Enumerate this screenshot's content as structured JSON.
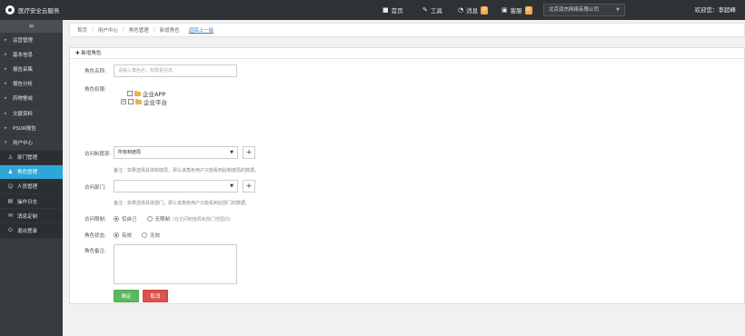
{
  "topbar": {
    "brand": "医疗安全云服务",
    "nav": [
      {
        "icon": "home-icon",
        "glyph": "■",
        "label": "首页"
      },
      {
        "icon": "wrench-icon",
        "glyph": "✎",
        "label": "工具"
      },
      {
        "icon": "bell-icon",
        "glyph": "◔",
        "label": "消息",
        "badge": "0"
      },
      {
        "icon": "service-icon",
        "glyph": "▣",
        "label": "客服",
        "badge": "0"
      }
    ],
    "company": "北京润杰网络有限公司",
    "welcome": "欢迎您：李超峰"
  },
  "sidebar": {
    "menu_icon": "menu-icon",
    "items": [
      {
        "label": "运营管理"
      },
      {
        "label": "基本信息"
      },
      {
        "label": "报告采集"
      },
      {
        "label": "报告分析"
      },
      {
        "label": "药物警戒"
      },
      {
        "label": "文献资料"
      },
      {
        "label": "PSUR报告"
      },
      {
        "label": "用户中心"
      }
    ],
    "children": [
      {
        "label": "部门管理",
        "icon": "org-icon",
        "glyph": "♙"
      },
      {
        "label": "角色管理",
        "icon": "role-icon",
        "glyph": "♟",
        "active": true
      },
      {
        "label": "人员管理",
        "icon": "user-icon",
        "glyph": "☺"
      },
      {
        "label": "操作日志",
        "icon": "log-icon",
        "glyph": "▤"
      },
      {
        "label": "消息定制",
        "icon": "message-icon",
        "glyph": "✉"
      },
      {
        "label": "退出登录",
        "icon": "power-icon",
        "glyph": "⏻"
      }
    ]
  },
  "breadcrumb": {
    "items": [
      "首页",
      "用户中心",
      "角色管理",
      "新增角色"
    ],
    "back": "返回上一级"
  },
  "form": {
    "title": "新增角色",
    "role_name_label": "角色名称:",
    "role_name_placeholder": "请输入角色名，权限看信息",
    "permission_label": "角色权限:",
    "tree": [
      "企业APP",
      "企业平台"
    ],
    "access_label": "访问制度部:",
    "access_value": "所有制度局",
    "access_note": "备注：如果选择具体制度局，那么该角色用户只能看到此制度局的数据。",
    "dept_label": "访问部门:",
    "dept_value": "",
    "dept_note": "备注：如果选择具体部门，那么该角色用户只能看到此部门的数据。",
    "limit_label": "访问限制:",
    "limit_options": [
      "仅自己",
      "无限制"
    ],
    "limit_hint": "(在访问制度局和部门范围内)",
    "status_label": "角色状态:",
    "status_options": [
      "有效",
      "无效"
    ],
    "remark_label": "角色备注:",
    "ok": "确定",
    "cancel": "取消"
  }
}
